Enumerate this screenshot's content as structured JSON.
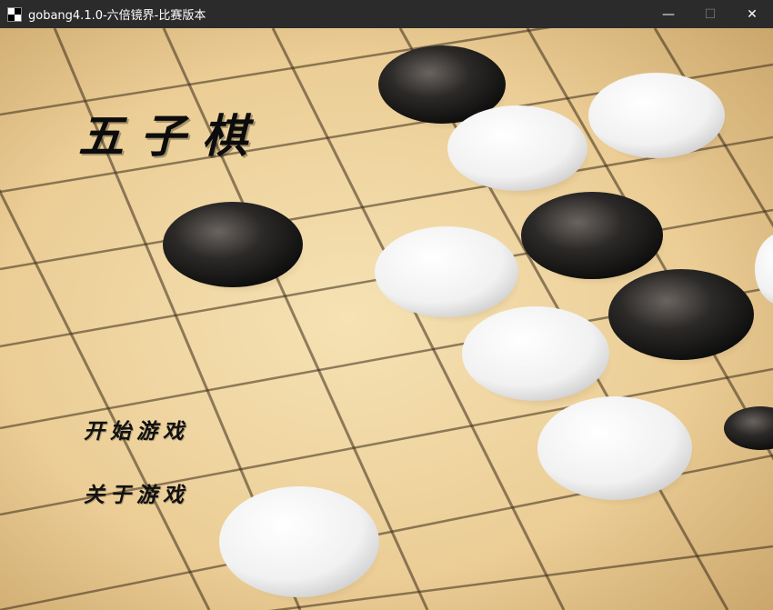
{
  "window": {
    "title": "gobang4.1.0-六倍镜界-比赛版本",
    "controls": {
      "minimize": "—",
      "maximize": "☐",
      "close": "✕"
    }
  },
  "game": {
    "title": "五子棋",
    "menu": {
      "start": "开始游戏",
      "about": "关于游戏"
    }
  },
  "colors": {
    "board_light": "#f3dcaa",
    "board_dark": "#c9a56a",
    "grid_line": "#3b2a17",
    "black_stone": "#1a1a1a",
    "white_stone": "#f4f4f4",
    "titlebar": "#2b2b2b"
  }
}
